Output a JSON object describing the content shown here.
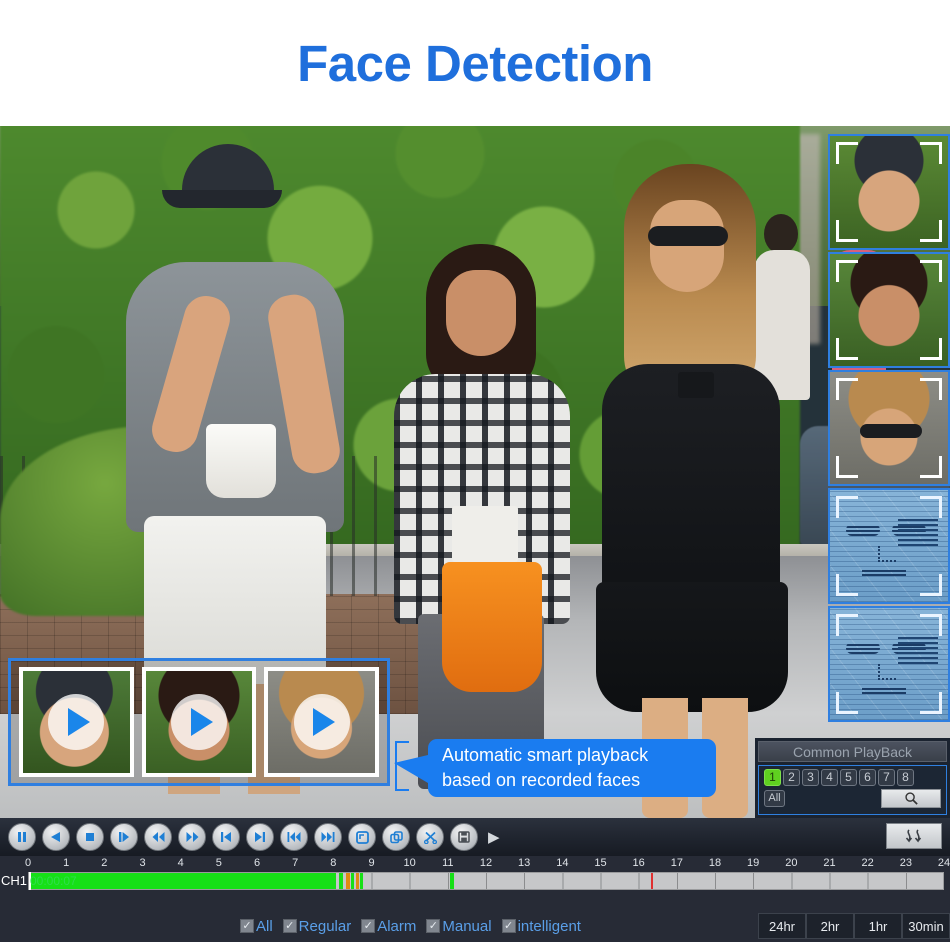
{
  "header": {
    "title": "Face Detection",
    "title_color": "#1f6fdc"
  },
  "video": {
    "scene_description": "Street scene with three pedestrians walking on a sidewalk"
  },
  "face_panel": {
    "label": "detected-faces-panel",
    "cards": [
      {
        "id": "face-1",
        "type": "photo",
        "subject": "man in black cap"
      },
      {
        "id": "face-2",
        "type": "photo",
        "subject": "woman with dark hair"
      },
      {
        "id": "face-3",
        "type": "photo",
        "subject": "woman with sunglasses"
      },
      {
        "id": "face-4",
        "type": "biometric-scan",
        "subject": "face recognition overlay"
      },
      {
        "id": "face-5",
        "type": "biometric-scan",
        "subject": "face recognition overlay"
      }
    ]
  },
  "thumbnails": {
    "items": [
      {
        "id": "thumb-1",
        "subject": "man in black cap",
        "play_icon": "play-icon"
      },
      {
        "id": "thumb-2",
        "subject": "woman with dark hair",
        "play_icon": "play-icon"
      },
      {
        "id": "thumb-3",
        "subject": "woman with sunglasses",
        "play_icon": "play-icon"
      }
    ]
  },
  "callout": {
    "line1": "Automatic smart playback",
    "line2": "based on recorded faces",
    "color": "#1a7cf0"
  },
  "common_playback": {
    "title": "Common PlayBack",
    "channels": [
      "1",
      "2",
      "3",
      "4",
      "5",
      "6",
      "7",
      "8"
    ],
    "active_channel": "1",
    "all_label": "All",
    "search_icon": "search-icon"
  },
  "controls": {
    "buttons": [
      {
        "name": "pause-button",
        "icon": "pause-icon"
      },
      {
        "name": "play-reverse-button",
        "icon": "play-reverse-icon"
      },
      {
        "name": "stop-button",
        "icon": "stop-icon"
      },
      {
        "name": "play-button",
        "icon": "play-frame-icon"
      },
      {
        "name": "rewind-button",
        "icon": "rewind-icon"
      },
      {
        "name": "fast-forward-button",
        "icon": "fast-forward-icon"
      },
      {
        "name": "previous-file-button",
        "icon": "skip-previous-icon"
      },
      {
        "name": "next-file-button",
        "icon": "skip-next-icon"
      },
      {
        "name": "slow-backward-button",
        "icon": "slow-backward-icon"
      },
      {
        "name": "slow-forward-button",
        "icon": "slow-forward-icon"
      },
      {
        "name": "fullscreen-button",
        "icon": "fullscreen-icon"
      },
      {
        "name": "sync-button",
        "icon": "sync-icon"
      },
      {
        "name": "clip-button",
        "icon": "scissors-icon"
      },
      {
        "name": "save-button",
        "icon": "save-icon"
      }
    ],
    "expand_icon": "expand-right-icon",
    "toggle_icon": "swap-arrows-icon"
  },
  "timeline": {
    "channel_label": "CH1",
    "current_time": "00:00:07",
    "ticks": [
      "0",
      "1",
      "2",
      "3",
      "4",
      "5",
      "6",
      "7",
      "8",
      "9",
      "10",
      "11",
      "12",
      "13",
      "14",
      "15",
      "16",
      "17",
      "18",
      "19",
      "20",
      "21",
      "22",
      "23",
      "24"
    ],
    "recorded_color": "#16e016",
    "alarm_color": "#e08a10",
    "empty_color": "#c6c7c9",
    "cursor_position_hour": 16.3,
    "segments": [
      {
        "start": 0.0,
        "end": 8.05,
        "type": "regular"
      },
      {
        "start": 8.12,
        "end": 8.22,
        "type": "regular"
      },
      {
        "start": 8.3,
        "end": 8.4,
        "type": "alarm"
      },
      {
        "start": 8.44,
        "end": 8.52,
        "type": "regular"
      },
      {
        "start": 8.56,
        "end": 8.64,
        "type": "alarm"
      },
      {
        "start": 8.68,
        "end": 8.76,
        "type": "regular"
      },
      {
        "start": 11.02,
        "end": 11.14,
        "type": "regular"
      }
    ]
  },
  "footer": {
    "checkboxes": [
      {
        "label": "All",
        "checked": true
      },
      {
        "label": "Regular",
        "checked": true
      },
      {
        "label": "Alarm",
        "checked": true
      },
      {
        "label": "Manual",
        "checked": true
      },
      {
        "label": "intelligent",
        "checked": true
      }
    ],
    "range_buttons": [
      "24hr",
      "2hr",
      "1hr",
      "30min"
    ]
  }
}
